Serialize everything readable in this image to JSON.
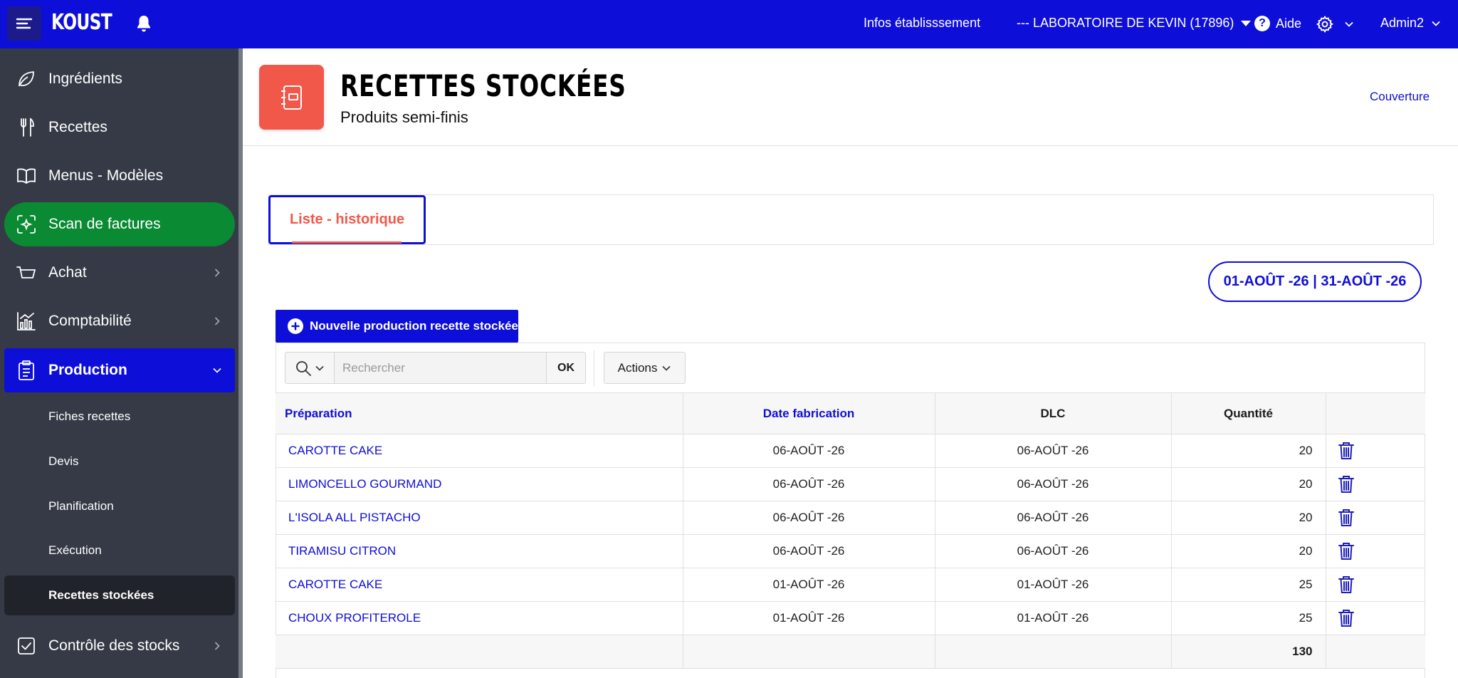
{
  "topbar": {
    "logo": "KOUST",
    "infos": "Infos établisssement",
    "lab": "--- LABORATOIRE DE KEVIN (17896)",
    "help": "Aide",
    "user": "Admin2",
    "colors": {
      "bar": "#0e0ed9",
      "burger_bg": "#1b1b8c"
    },
    "icons": [
      "menu-icon",
      "bell-icon",
      "help-icon",
      "gear-icon",
      "chevron-down-icon"
    ]
  },
  "sidebar": {
    "items": [
      {
        "label": "Ingrédients",
        "icon": "leaf-icon"
      },
      {
        "label": "Recettes",
        "icon": "fork-knife-icon"
      },
      {
        "label": "Menus - Modèles",
        "icon": "book-icon"
      },
      {
        "label": "Scan de factures",
        "icon": "scan-icon"
      },
      {
        "label": "Achat",
        "icon": "cart-icon"
      },
      {
        "label": "Comptabilité",
        "icon": "chart-icon"
      },
      {
        "label": "Production",
        "icon": "clipboard-icon"
      },
      {
        "label": "Contrôle des stocks",
        "icon": "checkbox-icon"
      }
    ],
    "sub": [
      {
        "label": "Fiches recettes"
      },
      {
        "label": "Devis"
      },
      {
        "label": "Planification"
      },
      {
        "label": "Exécution"
      },
      {
        "label": "Recettes stockées"
      }
    ],
    "colors": {
      "bg": "#353a46",
      "scan_active": "#0a8a32",
      "production_active": "#0e0ed9",
      "sub_active": "#202329"
    }
  },
  "header": {
    "title": "RECETTES STOCKÉES",
    "subtitle": "Produits semi-finis",
    "link": "Couverture",
    "icon_color": "#f2584a"
  },
  "tabs": [
    {
      "label": "Liste - historique"
    }
  ],
  "date_range": "01-AOÛT -26 | 31-AOÛT -26",
  "new_button": "Nouvelle production recette stockée",
  "search": {
    "placeholder": "Rechercher",
    "ok": "OK",
    "actions": "Actions"
  },
  "table": {
    "headers": [
      "Préparation",
      "Date fabrication",
      "DLC",
      "Quantité"
    ],
    "rows": [
      {
        "name": "CAROTTE CAKE",
        "date": "06-AOÛT -26",
        "dlc": "06-AOÛT -26",
        "qty": "20"
      },
      {
        "name": "LIMONCELLO GOURMAND",
        "date": "06-AOÛT -26",
        "dlc": "06-AOÛT -26",
        "qty": "20"
      },
      {
        "name": "L'ISOLA ALL PISTACHO",
        "date": "06-AOÛT -26",
        "dlc": "06-AOÛT -26",
        "qty": "20"
      },
      {
        "name": "TIRAMISU CITRON",
        "date": "06-AOÛT -26",
        "dlc": "06-AOÛT -26",
        "qty": "20"
      },
      {
        "name": "CAROTTE CAKE",
        "date": "01-AOÛT -26",
        "dlc": "01-AOÛT -26",
        "qty": "25"
      },
      {
        "name": "CHOUX PROFITEROLE",
        "date": "01-AOÛT -26",
        "dlc": "01-AOÛT -26",
        "qty": "25"
      }
    ],
    "total": "130"
  }
}
